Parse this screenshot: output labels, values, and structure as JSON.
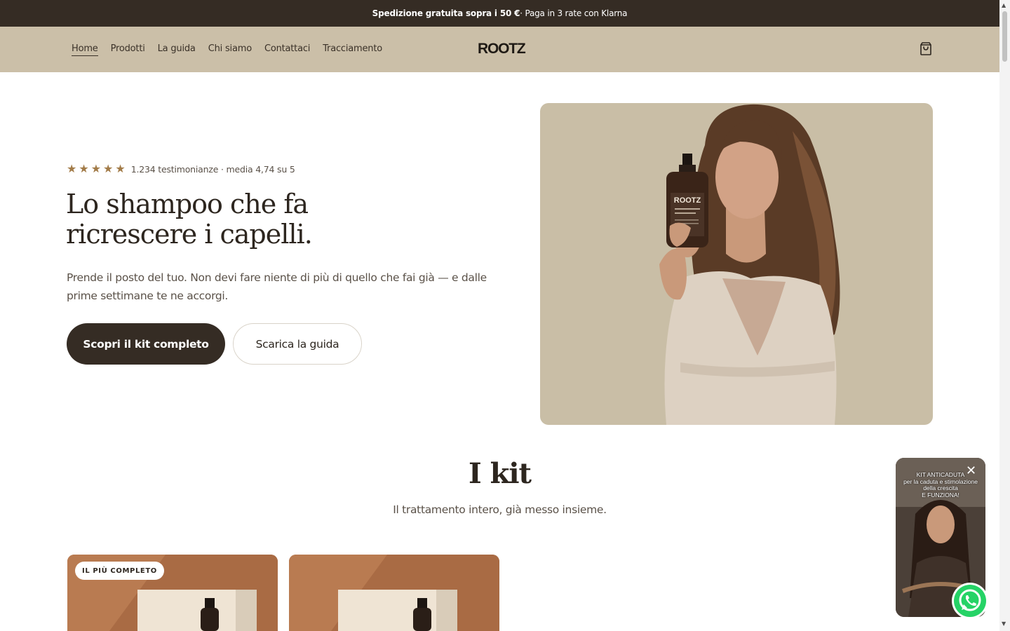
{
  "announcement": {
    "bold": "Spedizione gratuita sopra i 50 €",
    "rest": " · Paga in 3 rate con Klarna"
  },
  "header": {
    "nav": [
      "Home",
      "Prodotti",
      "La guida",
      "Chi siamo",
      "Contattaci",
      "Tracciamento"
    ],
    "logo": "ROOTZ",
    "cart_icon": "shopping-bag-icon"
  },
  "hero": {
    "rating_stars": 5,
    "rating_text": "1.234 testimonianze · media 4,74 su 5",
    "title_line1": "Lo shampoo che fa",
    "title_line2": "ricrescere i capelli.",
    "subtitle": "Prende il posto del tuo. Non devi fare niente di più di quello che fai già — e dalle prime settimane te ne accorgi.",
    "primary_button": "Scopri il kit completo",
    "secondary_button": "Scarica la guida",
    "bottle_label": "ROOTZ"
  },
  "kits": {
    "title": "I kit",
    "subtitle": "Il trattamento intero, già messo insieme.",
    "badge": "IL PIÙ COMPLETO"
  },
  "video_widget": {
    "caption_line1": "KIT ANTICADUTA",
    "caption_line2": "per la caduta e stimolazione",
    "caption_line3": "della crescita",
    "caption_line4": "E FUNZIONA!"
  },
  "colors": {
    "announcement_bg": "#352c24",
    "header_bg": "#cbbfa8",
    "hero_image_bg": "#c9bea6",
    "star": "#a27b48",
    "whatsapp": "#25d366"
  }
}
